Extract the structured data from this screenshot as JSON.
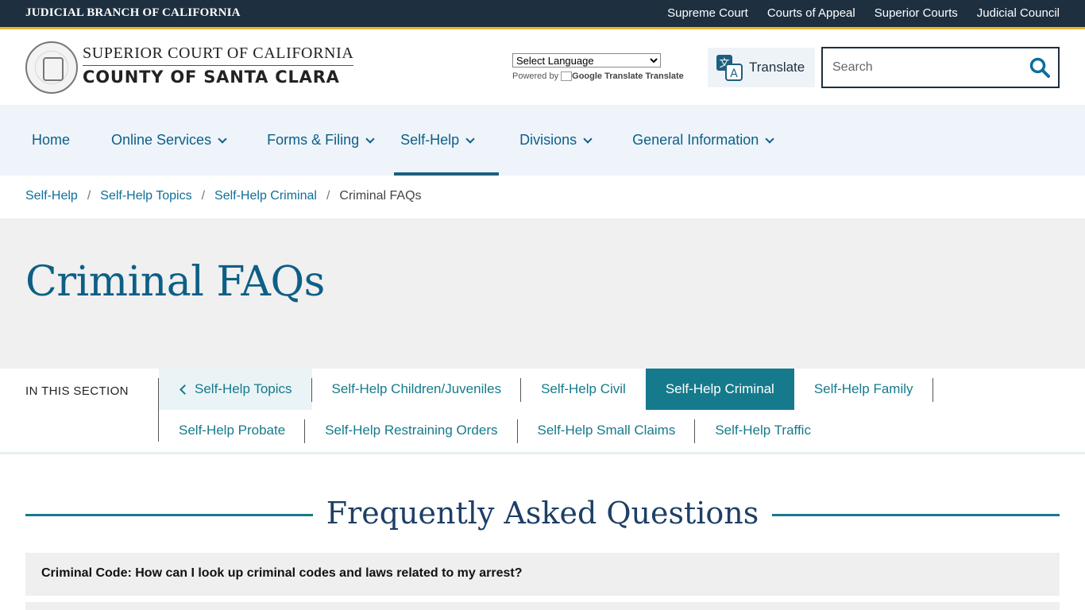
{
  "topbar": {
    "brand": "JUDICIAL BRANCH OF CALIFORNIA",
    "links": [
      "Supreme Court",
      "Courts of Appeal",
      "Superior Courts",
      "Judicial Council"
    ],
    "accent_color": "#f0b429",
    "background_color": "#1e2f3f"
  },
  "header": {
    "court_line1": "SUPERIOR COURT OF CALIFORNIA",
    "court_line2": "COUNTY OF SANTA CLARA",
    "seal_icon": "court-seal-icon",
    "language_select": "Select Language",
    "powered_by": "Powered by",
    "google_translate": "Google Translate",
    "translate_link": "Translate",
    "translate_button": "Translate",
    "search_placeholder": "Search"
  },
  "mainnav": {
    "items": [
      {
        "label": "Home"
      },
      {
        "label": "Online Services"
      },
      {
        "label": "Forms & Filing"
      },
      {
        "label": "Self-Help"
      },
      {
        "label": "Divisions"
      },
      {
        "label": "General Information"
      }
    ],
    "active_index": 3
  },
  "breadcrumb": {
    "items": [
      "Self-Help",
      "Self-Help Topics",
      "Self-Help Criminal"
    ],
    "current": "Criminal FAQs",
    "separator": "/"
  },
  "hero": {
    "title": "Criminal FAQs"
  },
  "section_nav": {
    "label": "IN THIS SECTION",
    "back": "Self-Help Topics",
    "row1": [
      "Self-Help Children/Juveniles",
      "Self-Help Civil",
      "Self-Help Criminal",
      "Self-Help Family"
    ],
    "row2": [
      "Self-Help Probate",
      "Self-Help Restraining Orders",
      "Self-Help Small Claims",
      "Self-Help Traffic"
    ],
    "current": "Self-Help Criminal",
    "current_color": "#157a8c"
  },
  "faq": {
    "heading": "Frequently Asked Questions",
    "questions": [
      "Criminal Code: How can I look up criminal codes and laws related to my arrest?"
    ]
  }
}
